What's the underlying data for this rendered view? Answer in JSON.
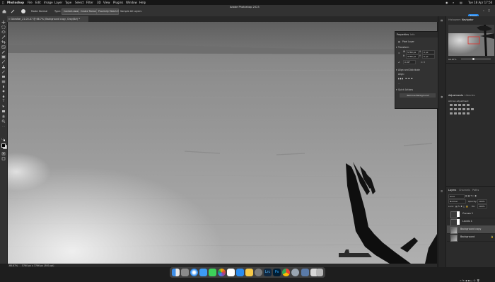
{
  "menubar": {
    "app": "Photoshop",
    "items": [
      "File",
      "Edit",
      "Image",
      "Layer",
      "Type",
      "Select",
      "Filter",
      "3D",
      "View",
      "Plugins",
      "Window",
      "Help"
    ],
    "window_title": "Adobe Photoshop 2023",
    "clock": "Tue 18 Apr  17:56"
  },
  "options": {
    "mode_label": "Mode:",
    "mode_value": "Normal",
    "type_label": "Type:",
    "content_aware": "Content-Aware",
    "create_texture": "Create Texture",
    "proximity_match": "Proximity Match",
    "sample_all": "Sample All Layers",
    "share": "Share"
  },
  "document": {
    "tab_title": "Gibraltar_21-05-07 @ 66.7% (Background copy, Gray/8#) *",
    "zoom": "66.67%",
    "dims": "5760 px x 3766 px (300 ppi)"
  },
  "properties": {
    "tabs": [
      "Properties",
      "Info"
    ],
    "layer_type": "Pixel Layer",
    "section_transform": "Transform",
    "w": "5760 px",
    "h": "3766 px",
    "x": "0 px",
    "y": "0 px",
    "angle": "0.00°",
    "align_section": "Align and Distribute",
    "align_label": "Align:",
    "quick_actions": "Quick Actions",
    "remove_bg": "Remove Background"
  },
  "right": {
    "top_tabs": [
      "Histogram",
      "Navigator"
    ],
    "zoom": "66.67%",
    "adj_tabs": [
      "Adjustments",
      "Libraries"
    ],
    "add_adj": "Add an adjustment",
    "layers_tabs": [
      "Layers",
      "Channels",
      "Paths"
    ],
    "kind": "Kind",
    "blend": "Normal",
    "opacity_label": "Opacity:",
    "opacity": "100%",
    "lock_label": "Lock:",
    "fill_label": "Fill:",
    "fill": "100%",
    "layers": [
      "Curves 1",
      "Levels 1",
      "Background copy",
      "Background"
    ]
  },
  "colors": {
    "accent": "#2d8ceb",
    "panel": "#323232",
    "navigator_box": "#e0302a"
  }
}
